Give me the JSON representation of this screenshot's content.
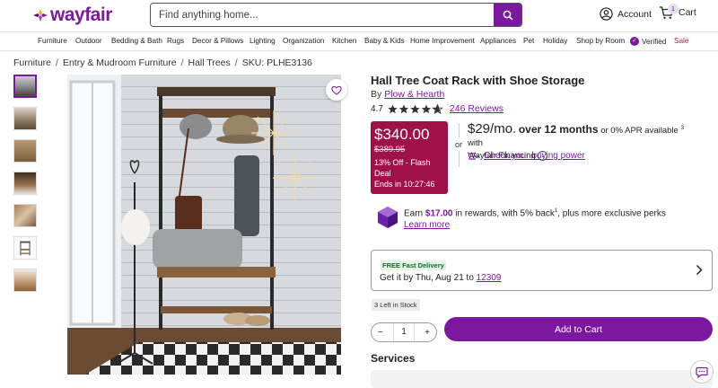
{
  "header": {
    "logo_text": "wayfair",
    "search_placeholder": "Find anything home...",
    "account_label": "Account",
    "cart_label": "Cart",
    "cart_count": "1",
    "brand_color": "#7b189f"
  },
  "nav": {
    "items": [
      "Furniture",
      "Outdoor",
      "Bedding & Bath",
      "Rugs",
      "Decor & Pillows",
      "Lighting",
      "Organization",
      "Kitchen",
      "Baby & Kids",
      "Home Improvement",
      "Appliances",
      "Pet",
      "Holiday",
      "Shop by Room",
      "Verified",
      "Sale"
    ]
  },
  "breadcrumb": {
    "items": [
      "Furniture",
      "Entry & Mudroom Furniture",
      "Hall Trees",
      "SKU: PLHE3136"
    ],
    "separator": "/"
  },
  "product": {
    "title": "Hall Tree Coat Rack with Shoe Storage",
    "by_prefix": "By",
    "brand": "Plow & Hearth",
    "rating": "4.7",
    "stars": 4.7,
    "reviews": "246 Reviews"
  },
  "price": {
    "current": "$340.00",
    "original": "$389.95",
    "discount": "13% Off - Flash Deal",
    "ends": "Ends in 10:27:46",
    "deal_color": "#a0114a"
  },
  "financing": {
    "or_label": "or",
    "monthly": "$29/mo.",
    "months": "over 12 months",
    "apr": "or 0% APR available",
    "footnote": "3",
    "with": "with",
    "provider": "Wayfair Financing",
    "info_icon": "i",
    "buying_power": "Check your buying power"
  },
  "rewards": {
    "prefix": "Earn",
    "amount": "$17.00",
    "middle": "in rewards, with 5% back",
    "footnote": "1",
    "suffix": ", plus more exclusive perks",
    "learn_more": "Learn more"
  },
  "delivery": {
    "badge": "FREE Fast Delivery",
    "prefix": "Get it by Thu, Aug 21 to",
    "zip": "12309"
  },
  "stock": "3 Left in Stock",
  "quantity": {
    "value": "1",
    "minus": "−",
    "plus": "+"
  },
  "add_to_cart": "Add to Cart",
  "services_title": "Services"
}
